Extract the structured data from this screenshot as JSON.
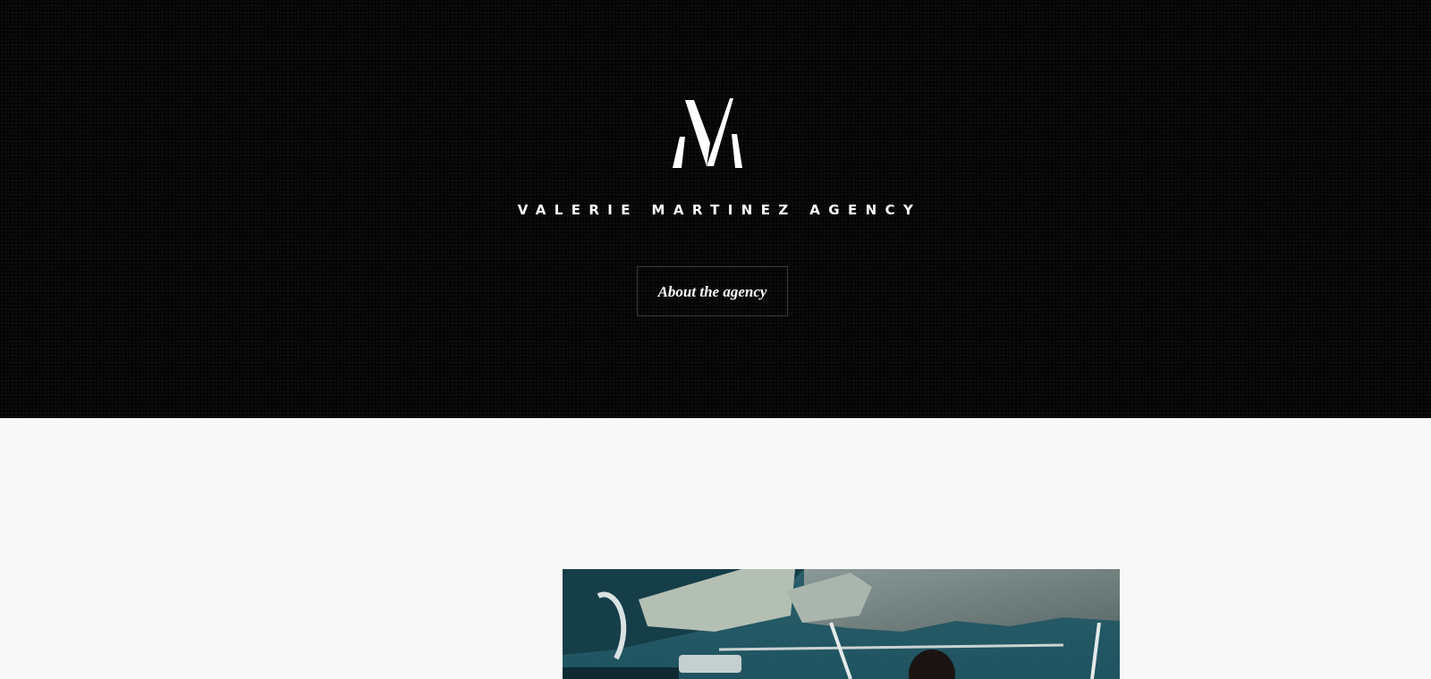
{
  "hero": {
    "logo_letter": "M",
    "agency_name": "VALERIE MARTINEZ AGENCY",
    "about_button_label": "About the agency"
  },
  "colors": {
    "hero_background": "#050505",
    "content_background": "#f8f8f8",
    "text_light": "#ffffff",
    "button_border": "#3a3a3a"
  }
}
